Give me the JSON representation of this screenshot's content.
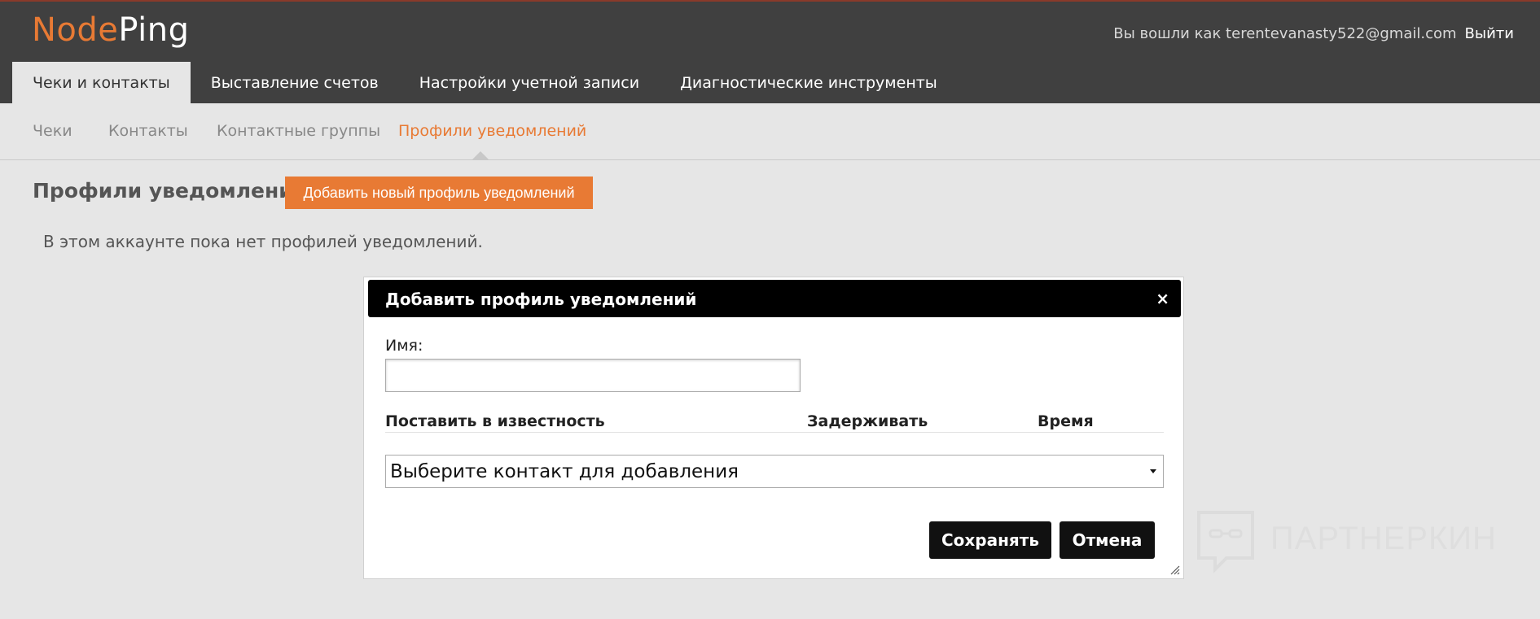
{
  "logo": {
    "part1": "Node",
    "part2": "Ping"
  },
  "user": {
    "logged_in_text": "Вы вошли как terentevanasty522@gmail.com",
    "logout": "Выйти"
  },
  "main_tabs": [
    {
      "label": "Чеки и контакты",
      "active": true
    },
    {
      "label": "Выставление счетов"
    },
    {
      "label": "Настройки учетной записи"
    },
    {
      "label": "Диагностические инструменты"
    }
  ],
  "sub_tabs": [
    {
      "label": "Чеки"
    },
    {
      "label": "Контакты"
    },
    {
      "label": "Контактные группы"
    },
    {
      "label": "Профили уведомлений",
      "active": true
    }
  ],
  "page": {
    "title": "Профили уведомлений",
    "add_button": "Добавить новый профиль уведомлений",
    "empty_message": "В этом аккаунте пока нет профилей уведомлений."
  },
  "modal": {
    "title": "Добавить профиль уведомлений",
    "close": "×",
    "name_label": "Имя:",
    "name_value": "",
    "columns": [
      "Поставить в известность",
      "Задерживать",
      "Время"
    ],
    "contact_select": "Выберите контакт для добавления",
    "save": "Сохранять",
    "cancel": "Отмена"
  },
  "watermark": "ПАРТНЕРКИН",
  "colors": {
    "accent": "#e87a34",
    "header_bg": "#404040",
    "modal_head": "#000000"
  }
}
